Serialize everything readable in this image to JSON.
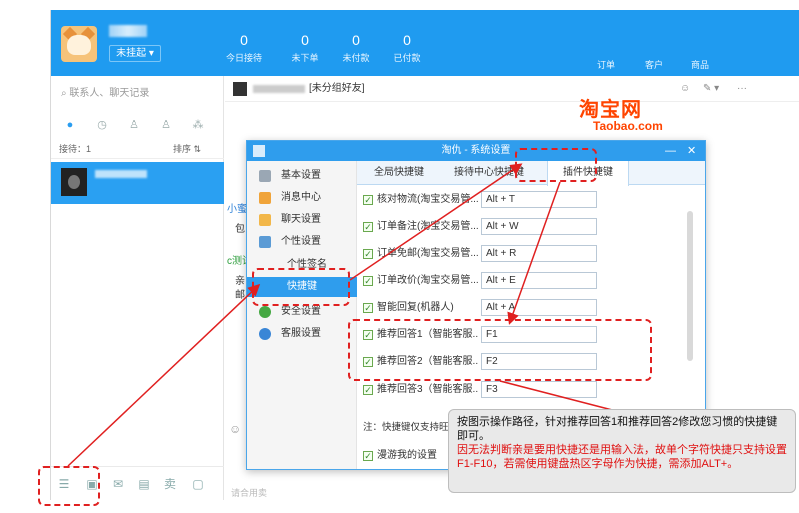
{
  "topbar": {
    "status": "未挂起",
    "stats": [
      {
        "num": "0",
        "label": "今日接待"
      },
      {
        "num": "0",
        "label": "未下单"
      },
      {
        "num": "0",
        "label": "未付款"
      },
      {
        "num": "0",
        "label": "已付款"
      }
    ],
    "links": [
      "订单",
      "客户",
      "商品"
    ]
  },
  "sidebar": {
    "search_placeholder": "联系人、聊天记录",
    "reception": "接待：1",
    "sort": "排序"
  },
  "chat": {
    "group_tag": "[未分组好友]",
    "fragments": [
      "小蜜(",
      "包",
      "c测试",
      "亲",
      "邮"
    ],
    "input_placeholder": "请合用卖"
  },
  "taobao_logo": {
    "cn": "淘宝网",
    "en": "Taobao.com"
  },
  "dialog": {
    "title": "淘仇 - 系统设置",
    "nav": [
      {
        "label": "基本设置",
        "icon": "gear-icon",
        "color": "#9aa7b4"
      },
      {
        "label": "消息中心",
        "icon": "mail-icon",
        "color": "#f0a43a"
      },
      {
        "label": "聊天设置",
        "icon": "chat-icon",
        "color": "#f2b74a"
      },
      {
        "label": "个性设置",
        "icon": "user-icon",
        "color": "#5b9bd5"
      }
    ],
    "nav_sub": [
      "个性签名",
      "快捷键"
    ],
    "nav_bottom": [
      {
        "label": "安全设置",
        "icon": "shield-icon",
        "color": "#45a843"
      },
      {
        "label": "客服设置",
        "icon": "service-icon",
        "color": "#3a86d6"
      }
    ],
    "tabs": [
      "全局快捷键",
      "接待中心快捷键",
      "插件快捷键"
    ],
    "rows": [
      {
        "label": "核对物流(淘宝交易管...",
        "value": "Alt + T"
      },
      {
        "label": "订单备注(淘宝交易管...",
        "value": "Alt + W"
      },
      {
        "label": "订单免邮(淘宝交易管...",
        "value": "Alt + R"
      },
      {
        "label": "订单改价(淘宝交易管...",
        "value": "Alt + E"
      },
      {
        "label": "智能回复(机器人)",
        "value": "Alt + A"
      },
      {
        "label": "推荐回答1（智能客服...",
        "value": "F1"
      },
      {
        "label": "推荐回答2（智能客服...",
        "value": "F2"
      },
      {
        "label": "推荐回答3（智能客服...",
        "value": "F3"
      }
    ],
    "note": "注：快捷键仅支持旺旺",
    "footer_check": "漫游我的设置"
  },
  "callout": {
    "line1": "按图示操作路径，针对推荐回答1和推荐回答2修改您习惯的快捷键即可。",
    "line2": "因无法判断亲是要用快捷还是用输入法，故单个字符快捷只支持设置F1-F10，若需使用键盘热区字母作为快捷，需添加ALT+。"
  }
}
